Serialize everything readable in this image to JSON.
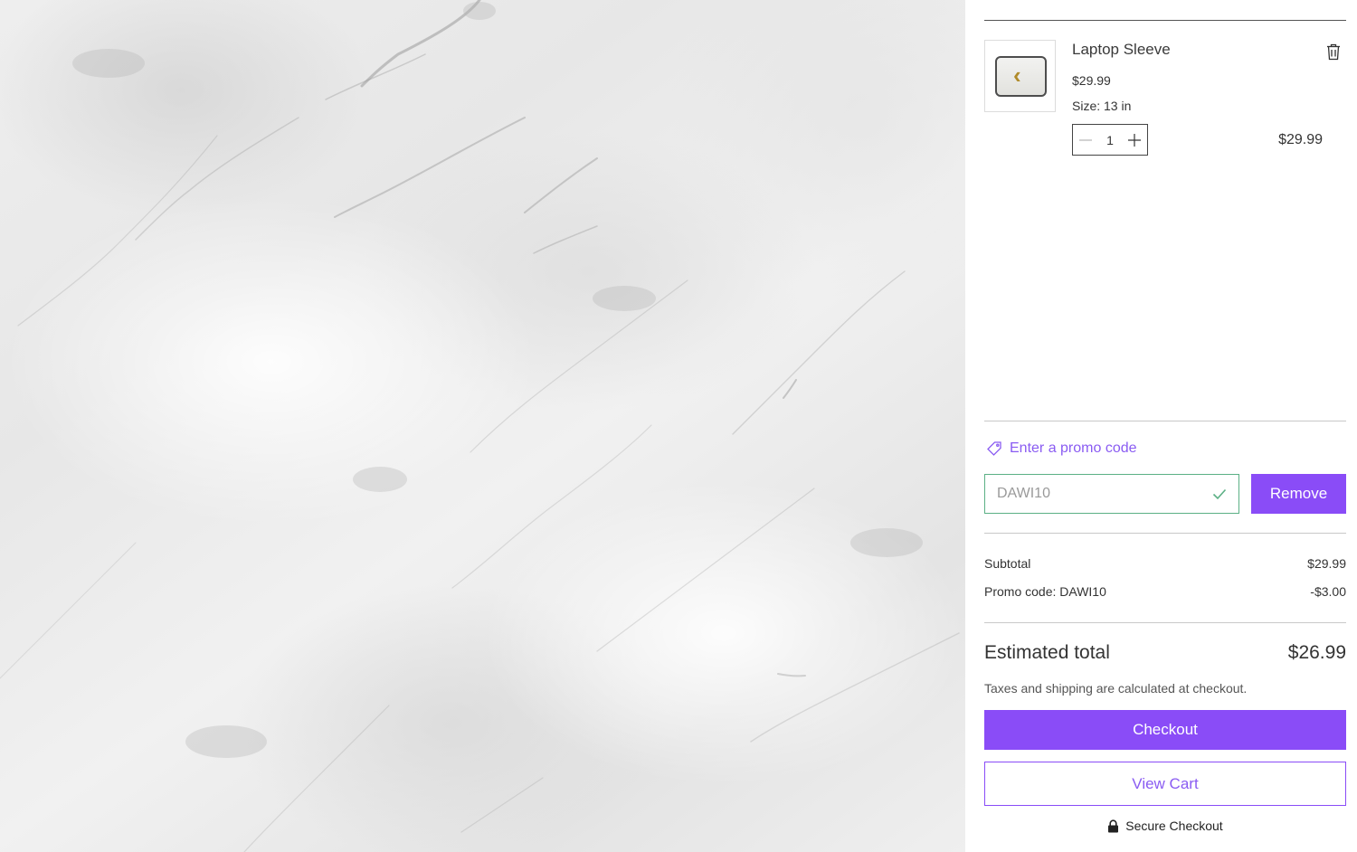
{
  "cart": {
    "item": {
      "name": "Laptop Sleeve",
      "price": "$29.99",
      "option": "Size: 13 in",
      "quantity": "1",
      "line_total": "$29.99"
    },
    "promo": {
      "link_label": "Enter a promo code",
      "code_value": "DAWI10",
      "remove_label": "Remove"
    },
    "summary": {
      "subtotal_label": "Subtotal",
      "subtotal_value": "$29.99",
      "promo_label": "Promo code: DAWI10",
      "promo_value": "-$3.00",
      "total_label": "Estimated total",
      "total_value": "$26.99",
      "tax_note": "Taxes and shipping are calculated at checkout."
    },
    "actions": {
      "checkout_label": "Checkout",
      "view_cart_label": "View Cart",
      "secure_label": "Secure Checkout"
    }
  },
  "icons": {
    "delete": "trash-icon",
    "decrease": "minus-icon",
    "increase": "plus-icon",
    "promo": "tag-icon",
    "valid": "check-icon",
    "secure": "lock-icon"
  },
  "colors": {
    "accent": "#8a4cf7",
    "valid": "#5bb085",
    "text": "#333333"
  }
}
